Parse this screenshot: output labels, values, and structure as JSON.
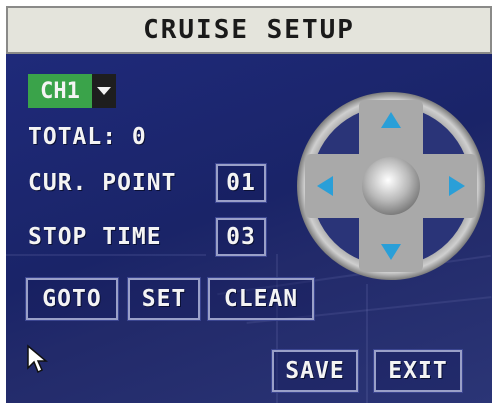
{
  "title": "CRUISE SETUP",
  "channel": {
    "value": "CH1",
    "icon": "chevron-down-icon"
  },
  "total": {
    "label": "TOTAL: 0"
  },
  "cur_point": {
    "label": "CUR. POINT",
    "value": "01"
  },
  "stop_time": {
    "label": "STOP TIME",
    "value": "03"
  },
  "buttons": {
    "goto": "GOTO",
    "set": "SET",
    "clean": "CLEAN",
    "save": "SAVE",
    "exit": "EXIT"
  },
  "ptz": {
    "icons": [
      "ptz-up-icon",
      "ptz-down-icon",
      "ptz-left-icon",
      "ptz-right-icon",
      "ptz-center-icon"
    ]
  },
  "colors": {
    "panel": "#1f2a7a",
    "channel_bg": "#3aa34a",
    "arrow_blue": "#2a9fd8",
    "ring": "#bdbdbd"
  },
  "cursor": "mouse-pointer-icon"
}
